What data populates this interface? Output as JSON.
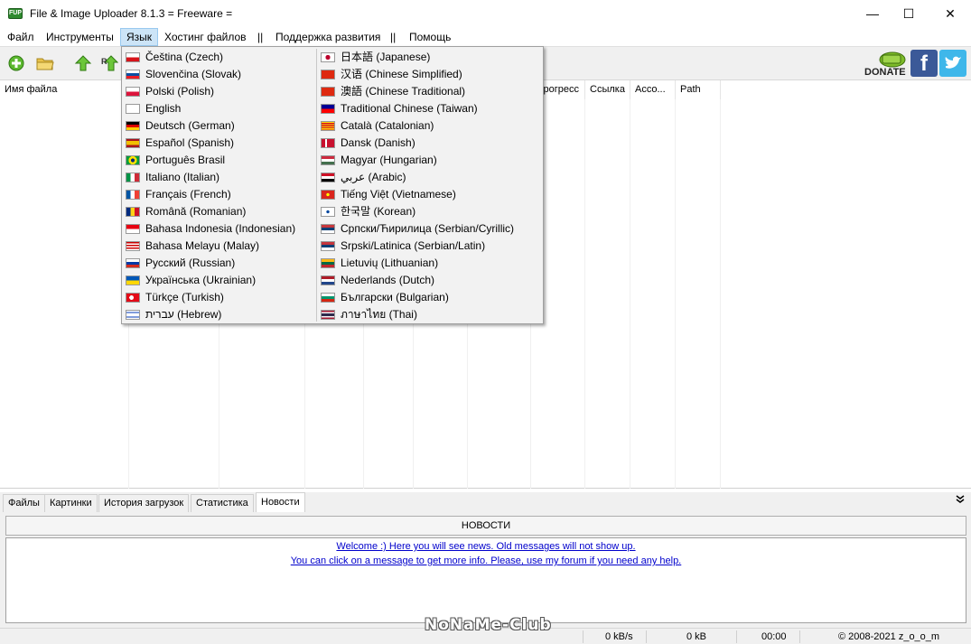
{
  "window": {
    "title": "File & Image Uploader 8.1.3  = Freeware =",
    "app_icon_text": "FUP",
    "controls": {
      "minimize": "—",
      "maximize": "☐",
      "close": "✕"
    }
  },
  "menu": {
    "file": "Файл",
    "tools": "Инструменты",
    "language": "Язык",
    "hosting": "Хостинг файлов",
    "sep1": "||",
    "support": "Поддержка развития",
    "sep2": "||",
    "help": "Помощь"
  },
  "toolbar": {
    "icons": [
      "add-icon",
      "folder-icon",
      "upload-icon",
      "upload-all-icon"
    ],
    "donate_label": "DONATE",
    "facebook_label": "f"
  },
  "filelist": {
    "columns": [
      "Имя файла",
      "",
      "",
      "",
      "",
      "",
      "Прогресс",
      "Ссылка",
      "Acco...",
      "Path"
    ]
  },
  "language_menu": {
    "left": [
      {
        "label": "Čeština (Czech)",
        "flag": "czech"
      },
      {
        "label": "Slovenčina (Slovak)",
        "flag": "slovak"
      },
      {
        "label": "Polski (Polish)",
        "flag": "polish"
      },
      {
        "label": "English",
        "flag": "uk"
      },
      {
        "label": "Deutsch (German)",
        "flag": "german"
      },
      {
        "label": "Español (Spanish)",
        "flag": "spanish"
      },
      {
        "label": "Português Brasil",
        "flag": "brazil"
      },
      {
        "label": "Italiano (Italian)",
        "flag": "italian"
      },
      {
        "label": "Français (French)",
        "flag": "french"
      },
      {
        "label": "Română (Romanian)",
        "flag": "romanian"
      },
      {
        "label": "Bahasa Indonesia (Indonesian)",
        "flag": "indonesian"
      },
      {
        "label": "Bahasa Melayu (Malay)",
        "flag": "malay"
      },
      {
        "label": "Русский (Russian)",
        "flag": "russian"
      },
      {
        "label": "Українська (Ukrainian)",
        "flag": "ukrainian"
      },
      {
        "label": "Türkçe (Turkish)",
        "flag": "turkish"
      },
      {
        "label": "עברית (Hebrew)",
        "flag": "israel"
      }
    ],
    "right": [
      {
        "label": "日本語 (Japanese)",
        "flag": "japan"
      },
      {
        "label": "汉语 (Chinese Simplified)",
        "flag": "china"
      },
      {
        "label": "澳語 (Chinese Traditional)",
        "flag": "china"
      },
      {
        "label": "Traditional Chinese (Taiwan)",
        "flag": "taiwan"
      },
      {
        "label": "Català (Catalonian)",
        "flag": "catalan"
      },
      {
        "label": "Dansk (Danish)",
        "flag": "danish"
      },
      {
        "label": "Magyar (Hungarian)",
        "flag": "hungarian"
      },
      {
        "label": "عربي (Arabic)",
        "flag": "arabic"
      },
      {
        "label": "Tiếng Việt (Vietnamese)",
        "flag": "vietnam"
      },
      {
        "label": "한국말 (Korean)",
        "flag": "korean"
      },
      {
        "label": "Српски/Ћирилица (Serbian/Cyrillic)",
        "flag": "serbian"
      },
      {
        "label": "Srpski/Latinica (Serbian/Latin)",
        "flag": "serbian"
      },
      {
        "label": "Lietuvių (Lithuanian)",
        "flag": "lithuanian"
      },
      {
        "label": "Nederlands (Dutch)",
        "flag": "dutch"
      },
      {
        "label": "Български (Bulgarian)",
        "flag": "bulgarian"
      },
      {
        "label": "ภาษาไทย (Thai)",
        "flag": "thai"
      }
    ]
  },
  "tabs": [
    "Файлы",
    "Картинки",
    "История загрузок",
    "Статистика",
    "Новости"
  ],
  "active_tab": "Новости",
  "news": {
    "header": "НОВОСТИ",
    "lines": [
      "Welcome :) Here you will see news. Old messages will not show up.",
      "You can click on a message to get more info. Please, use my forum if you need any help."
    ]
  },
  "status": {
    "speed": "0 kB/s",
    "size": "0 kB",
    "time": "00:00",
    "copyright": "© 2008-2021 z_o_o_m"
  },
  "watermark": "NoNaMe-Club",
  "colors": {
    "menu_highlight": "#cce4f7",
    "link": "#0000cc",
    "facebook": "#3b5998",
    "twitter": "#3fb7ea"
  }
}
